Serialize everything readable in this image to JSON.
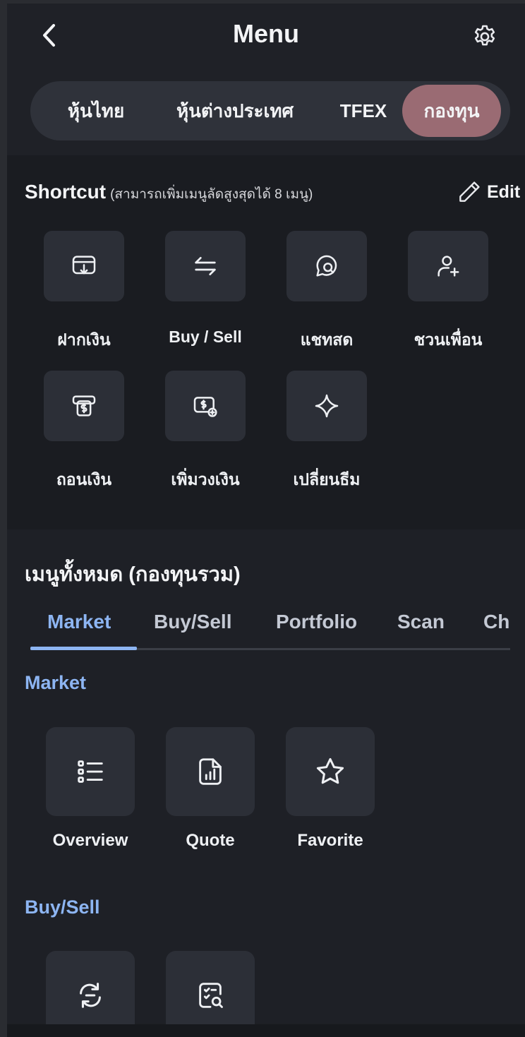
{
  "header": {
    "title": "Menu",
    "back_icon": "chevron-left-icon",
    "settings_icon": "gear-icon"
  },
  "segments": [
    {
      "label": "หุ้นไทย",
      "active": false
    },
    {
      "label": "หุ้นต่างประเทศ",
      "active": false
    },
    {
      "label": "TFEX",
      "active": false
    },
    {
      "label": "กองทุน",
      "active": true
    }
  ],
  "shortcut": {
    "title": "Shortcut",
    "subtitle": "(สามารถเพิ่มเมนูลัดสูงสุดได้ 8 เมนู)",
    "edit_label": "Edit",
    "items": [
      {
        "label": "ฝากเงิน",
        "icon": "deposit-icon"
      },
      {
        "label": "Buy / Sell",
        "icon": "swap-arrows-icon"
      },
      {
        "label": "แชทสด",
        "icon": "chat-icon"
      },
      {
        "label": "ชวนเพื่อน",
        "icon": "add-friend-icon"
      },
      {
        "label": "ถอนเงิน",
        "icon": "withdraw-icon"
      },
      {
        "label": "เพิ่มวงเงิน",
        "icon": "increase-limit-icon"
      },
      {
        "label": "เปลี่ยนธีม",
        "icon": "sparkle-icon"
      }
    ]
  },
  "all_menu": {
    "title": "เมนูทั้งหมด (กองทุนรวม)",
    "tabs": [
      {
        "label": "Market",
        "active": true
      },
      {
        "label": "Buy/Sell",
        "active": false
      },
      {
        "label": "Portfolio",
        "active": false
      },
      {
        "label": "Scan",
        "active": false
      },
      {
        "label": "Ch",
        "active": false
      }
    ],
    "sections": [
      {
        "heading": "Market",
        "items": [
          {
            "label": "Overview",
            "icon": "list-icon"
          },
          {
            "label": "Quote",
            "icon": "document-chart-icon"
          },
          {
            "label": "Favorite",
            "icon": "star-icon"
          }
        ]
      },
      {
        "heading": "Buy/Sell",
        "items": [
          {
            "label": "",
            "icon": "exchange-arrows-icon"
          },
          {
            "label": "",
            "icon": "order-search-icon"
          }
        ]
      }
    ]
  },
  "colors": {
    "accent_blue": "#8db5f2",
    "active_segment": "#9a6b73",
    "tile_bg": "#2c2f37",
    "background": "#1d1f24"
  }
}
